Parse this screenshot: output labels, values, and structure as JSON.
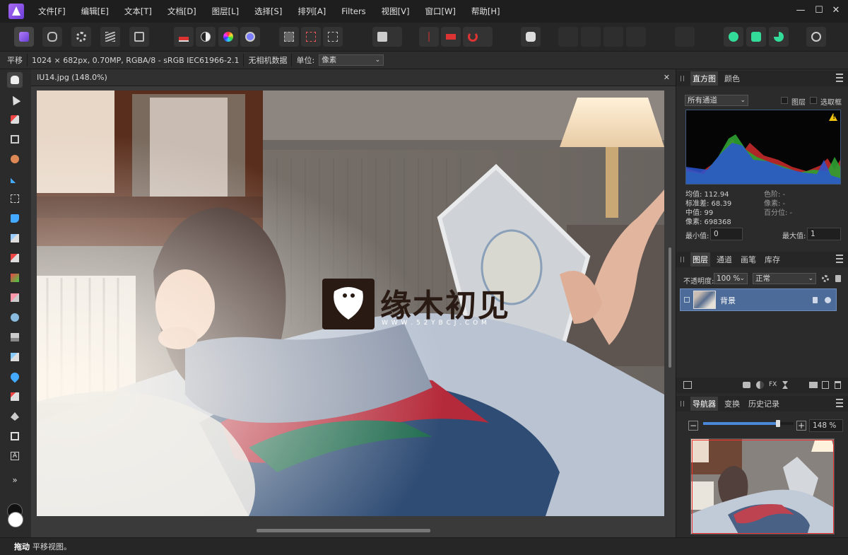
{
  "app": {
    "name": "Affinity Photo"
  },
  "menu": [
    "文件[F]",
    "编辑[E]",
    "文本[T]",
    "文档[D]",
    "图层[L]",
    "选择[S]",
    "排列[A]",
    "Filters",
    "视图[V]",
    "窗口[W]",
    "帮助[H]"
  ],
  "window_controls": {
    "minimize": "—",
    "maximize": "☐",
    "close": "✕"
  },
  "toolbar": {
    "personas": [
      "photo-persona-icon",
      "liquify-persona-icon",
      "develop-persona-icon",
      "tone-mapping-persona-icon",
      "export-persona-icon"
    ],
    "adjust": [
      "levels-icon",
      "auto-contrast-icon",
      "auto-colors-icon",
      "auto-white-balance-icon"
    ]
  },
  "context": {
    "tool_name": "平移",
    "image_info": "1024 × 682px, 0.70MP, RGBA/8 - sRGB IEC61966-2.1",
    "camera": "无相机数据",
    "unit_label": "单位:",
    "unit_value": "像素"
  },
  "document": {
    "tab_title": "IU14.jpg (148.0%)",
    "close": "✕",
    "watermark_text": "缘木初见",
    "watermark_url": "W W W . 5 2 Y B C J . C O M"
  },
  "histogram": {
    "tabs": [
      "直方图",
      "颜色"
    ],
    "channel": "所有通道",
    "layer_label": "图层",
    "marquee_label": "选取框",
    "stats_left": [
      "均值: 112.94",
      "标准差: 68.39",
      "中值: 99",
      "像素: 698368"
    ],
    "stats_right": [
      "色阶: -",
      "像素: -",
      "百分位: -"
    ],
    "min_label": "最小值:",
    "min_value": "0",
    "max_label": "最大值:",
    "max_value": "1",
    "warning": "!"
  },
  "layers": {
    "tabs": [
      "图层",
      "通道",
      "画笔",
      "库存"
    ],
    "opacity_label": "不透明度:",
    "opacity_value": "100 %",
    "blend_mode": "正常",
    "items": [
      {
        "name": "背景"
      }
    ]
  },
  "navigator": {
    "tabs": [
      "导航器",
      "变换",
      "历史记录"
    ],
    "zoom_value": "148 %",
    "zoom_fraction": 0.83
  },
  "status": {
    "bold": "拖动",
    "text": "平移视图。"
  },
  "colors": {
    "accent": "#4a6ea0",
    "layer_selected": "#4c6b98",
    "watermark_bg": "#2a1a14"
  }
}
